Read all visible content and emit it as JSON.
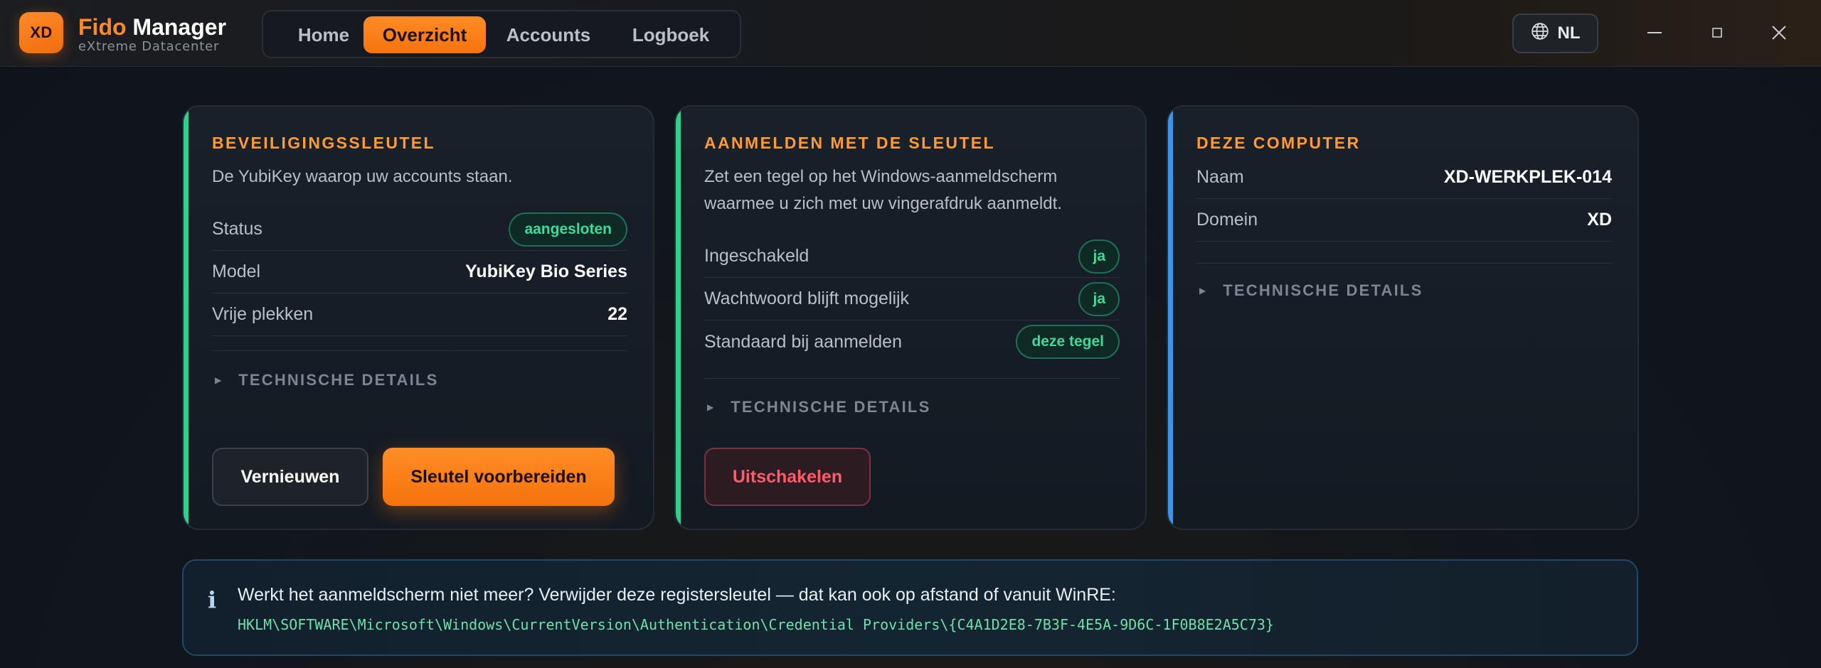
{
  "app": {
    "logo_text": "XD",
    "name_accent": "Fido",
    "name_rest": " Manager",
    "subtitle": "eXtreme Datacenter"
  },
  "nav": {
    "items": [
      {
        "label": "Home"
      },
      {
        "label": "Overzicht",
        "active": true
      },
      {
        "label": "Accounts"
      },
      {
        "label": "Logboek"
      }
    ]
  },
  "language": {
    "code": "NL",
    "icon": "globe-icon"
  },
  "window_controls": [
    "minimize-icon",
    "maximize-icon",
    "close-icon"
  ],
  "colors": {
    "accent": "#ff8a26",
    "success": "#3fd99c",
    "danger": "#ff5b6b",
    "card_green": "#2fcf8f",
    "card_blue": "#3b95e8"
  },
  "cards": [
    {
      "title": "BEVEILIGINGSSLEUTEL",
      "description": "De YubiKey waarop uw accounts staan.",
      "rows": [
        {
          "label": "Status",
          "value": "aangesloten",
          "type": "pill"
        },
        {
          "label": "Model",
          "value": "YubiKey Bio Series"
        },
        {
          "label": "Vrije plekken",
          "value": "22"
        }
      ],
      "details_label": "TECHNISCHE DETAILS",
      "buttons": [
        "Vernieuwen",
        "Sleutel voorbereiden"
      ]
    },
    {
      "title": "AANMELDEN MET DE SLEUTEL",
      "description": "Zet een tegel op het Windows-aanmeldscherm waarmee u zich met uw vingerafdruk aanmeldt.",
      "rows": [
        {
          "label": "Ingeschakeld",
          "value": "ja",
          "type": "pill"
        },
        {
          "label": "Wachtwoord blijft mogelijk",
          "value": "ja",
          "type": "pill"
        },
        {
          "label": "Standaard bij aanmelden",
          "value": "deze tegel",
          "type": "pill"
        }
      ],
      "details_label": "TECHNISCHE DETAILS",
      "buttons": [
        "Uitschakelen"
      ]
    },
    {
      "title": "DEZE COMPUTER",
      "rows": [
        {
          "label": "Naam",
          "value": "XD-WERKPLEK-014"
        },
        {
          "label": "Domein",
          "value": "XD"
        }
      ],
      "details_label": "TECHNISCHE DETAILS"
    }
  ],
  "banner": {
    "icon": "info-icon",
    "text": "Werkt het aanmeldscherm niet meer? Verwijder deze registersleutel — dat kan ook op afstand of vanuit WinRE:",
    "code": "HKLM\\SOFTWARE\\Microsoft\\Windows\\CurrentVersion\\Authentication\\Credential Providers\\{C4A1D2E8-7B3F-4E5A-9D6C-1F0B8E2A5C73}"
  }
}
